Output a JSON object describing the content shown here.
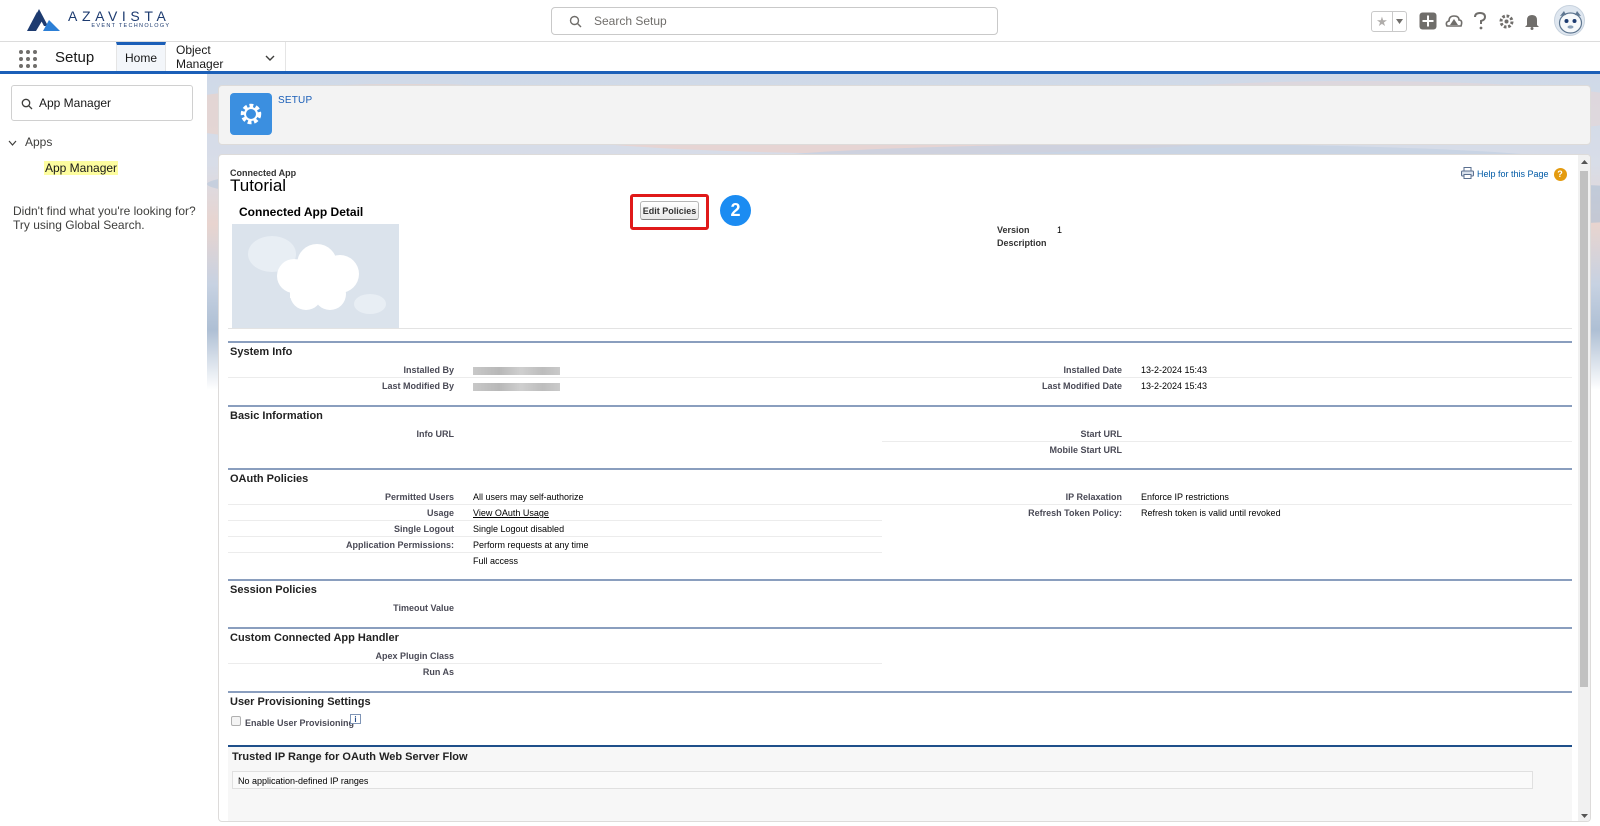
{
  "header": {
    "logo_name": "AZAVISTA",
    "logo_sub": "EVENT TECHNOLOGY",
    "search_placeholder": "Search Setup",
    "icons": [
      "star-icon",
      "chevron-down-icon",
      "add-icon",
      "trailhead-icon",
      "help-icon",
      "gear-icon",
      "bell-icon",
      "avatar"
    ]
  },
  "nav": {
    "app_name": "Setup",
    "tabs": [
      {
        "label": "Home",
        "active": true
      },
      {
        "label": "Object Manager",
        "active": false
      }
    ]
  },
  "sidebar": {
    "quickfind_value": "App Manager",
    "tree_group": "Apps",
    "tree_item": "App Manager",
    "help_line1": "Didn't find what you're looking for?",
    "help_line2": "Try using Global Search."
  },
  "setup_card": {
    "label": "SETUP"
  },
  "page": {
    "type": "Connected App",
    "title": "Tutorial",
    "help_link": "Help for this Page",
    "help_q": "?",
    "detail_title": "Connected App Detail",
    "edit_button": "Edit Policies",
    "step_badge": "2",
    "version_label": "Version",
    "version_value": "1",
    "description_label": "Description"
  },
  "sections": {
    "system_info": {
      "title": "System Info",
      "installed_by": "Installed By",
      "last_modified_by": "Last Modified By",
      "installed_date_label": "Installed Date",
      "installed_date": "13-2-2024 15:43",
      "last_modified_date_label": "Last Modified Date",
      "last_modified_date": "13-2-2024 15:43"
    },
    "basic_info": {
      "title": "Basic Information",
      "info_url": "Info URL",
      "start_url": "Start URL",
      "mobile_start_url": "Mobile Start URL"
    },
    "oauth": {
      "title": "OAuth Policies",
      "permitted_users_label": "Permitted Users",
      "permitted_users": "All users may self-authorize",
      "usage_label": "Usage",
      "usage_link": "View OAuth Usage",
      "single_logout_label": "Single Logout",
      "single_logout": "Single Logout disabled",
      "app_permissions_label": "Application Permissions:",
      "app_permissions_1": "Perform requests at any time",
      "app_permissions_2": "Full access",
      "ip_relaxation_label": "IP Relaxation",
      "ip_relaxation": "Enforce IP restrictions",
      "refresh_token_label": "Refresh Token Policy:",
      "refresh_token": "Refresh token is valid until revoked"
    },
    "session": {
      "title": "Session Policies",
      "timeout_label": "Timeout Value"
    },
    "handler": {
      "title": "Custom Connected App Handler",
      "apex_label": "Apex Plugin Class",
      "run_as_label": "Run As"
    },
    "provisioning": {
      "title": "User Provisioning Settings",
      "enable_label": "Enable User Provisioning",
      "info": "i"
    },
    "trusted_ip": {
      "title": "Trusted IP Range for OAuth Web Server Flow",
      "empty_text": "No application-defined IP ranges"
    }
  }
}
